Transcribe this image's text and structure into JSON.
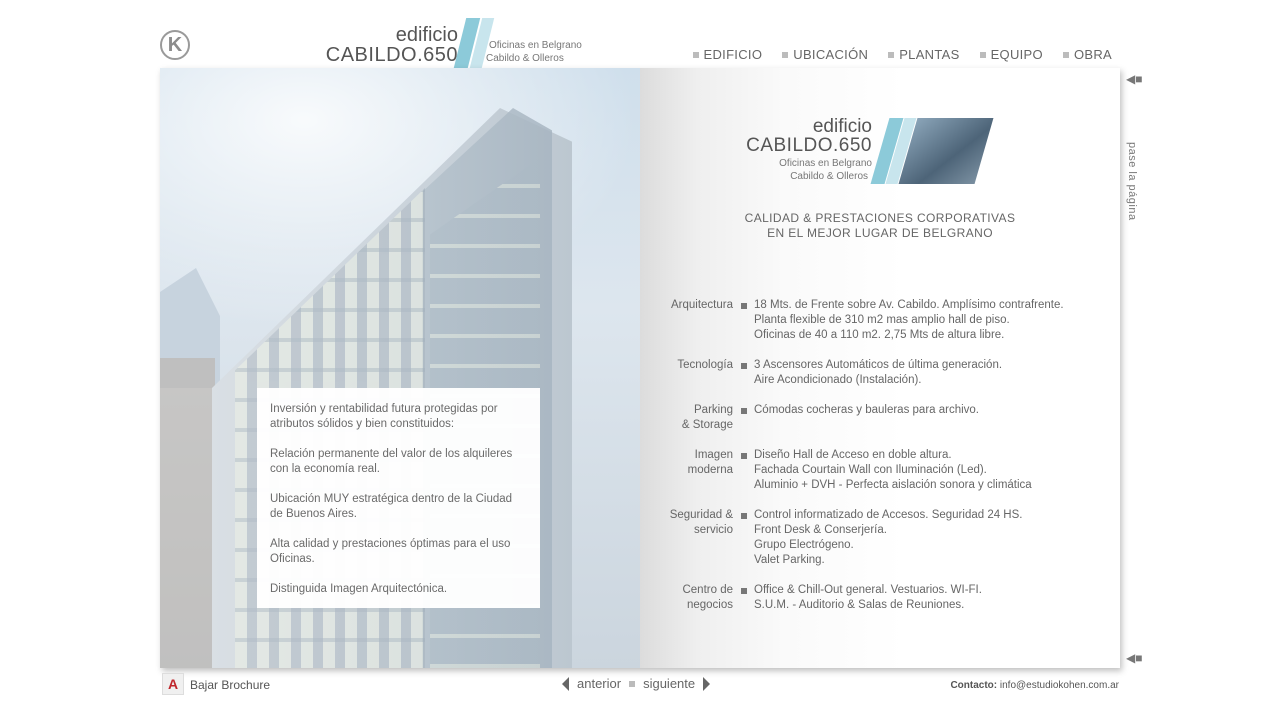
{
  "header": {
    "logo_letter": "K",
    "brand_top": "edificio",
    "brand_main": "CABILDO.650",
    "brand_sub1": "Oficinas en Belgrano",
    "brand_sub2": "Cabildo & Olleros"
  },
  "nav": {
    "items": [
      {
        "label": "EDIFICIO"
      },
      {
        "label": "UBICACIÓN"
      },
      {
        "label": "PLANTAS"
      },
      {
        "label": "EQUIPO"
      },
      {
        "label": "OBRA"
      }
    ]
  },
  "left_page": {
    "paragraphs": [
      "Inversión y rentabilidad futura protegidas por atributos sólidos y bien constituidos:",
      "Relación permanente del valor de los alquileres con la economía real.",
      "Ubicación MUY estratégica dentro de la Ciudad de Buenos Aires.",
      "Alta calidad y prestaciones óptimas para el uso Oficinas.",
      "Distinguida Imagen Arquitectónica."
    ]
  },
  "right_page": {
    "brand_top": "edificio",
    "brand_main": "CABILDO.650",
    "brand_sub1": "Oficinas en Belgrano",
    "brand_sub2": "Cabildo & Olleros",
    "tagline1": "CALIDAD & PRESTACIONES CORPORATIVAS",
    "tagline2": "EN EL MEJOR LUGAR DE BELGRANO",
    "features": [
      {
        "label1": "Arquitectura",
        "label2": "",
        "lines": [
          "18 Mts. de Frente sobre Av. Cabildo. Amplísimo contrafrente.",
          "Planta flexible de 310 m2 mas amplio hall de piso.",
          "Oficinas de 40 a 110 m2. 2,75 Mts de altura libre."
        ]
      },
      {
        "label1": "Tecnología",
        "label2": "",
        "lines": [
          "3 Ascensores Automáticos de última generación.",
          "Aire Acondicionado (Instalación)."
        ]
      },
      {
        "label1": "Parking",
        "label2": "& Storage",
        "lines": [
          "Cómodas cocheras y bauleras para archivo."
        ]
      },
      {
        "label1": "Imagen",
        "label2": "moderna",
        "lines": [
          "Diseño Hall de Acceso en doble altura.",
          "Fachada Courtain Wall con Iluminación (Led).",
          "Aluminio + DVH - Perfecta aislación sonora y climática"
        ]
      },
      {
        "label1": "Seguridad &",
        "label2": "servicio",
        "lines": [
          "Control informatizado de Accesos. Seguridad 24 HS.",
          "Front Desk & Conserjería.",
          "Grupo Electrógeno.",
          "Valet Parking."
        ]
      },
      {
        "label1": "Centro de",
        "label2": "negocios",
        "lines": [
          "Office & Chill-Out general. Vestuarios. WI-FI.",
          "S.U.M. - Auditorio & Salas de Reuniones."
        ]
      }
    ]
  },
  "side": {
    "turn_label": "pase la página",
    "arrow_icon": "🡸"
  },
  "footer": {
    "pdf_icon": "⅄",
    "brochure_label": "Bajar Brochure",
    "prev_label": "anterior",
    "next_label": "siguiente",
    "contact_label": "Contacto:",
    "contact_email": "info@estudiokohen.com.ar"
  }
}
